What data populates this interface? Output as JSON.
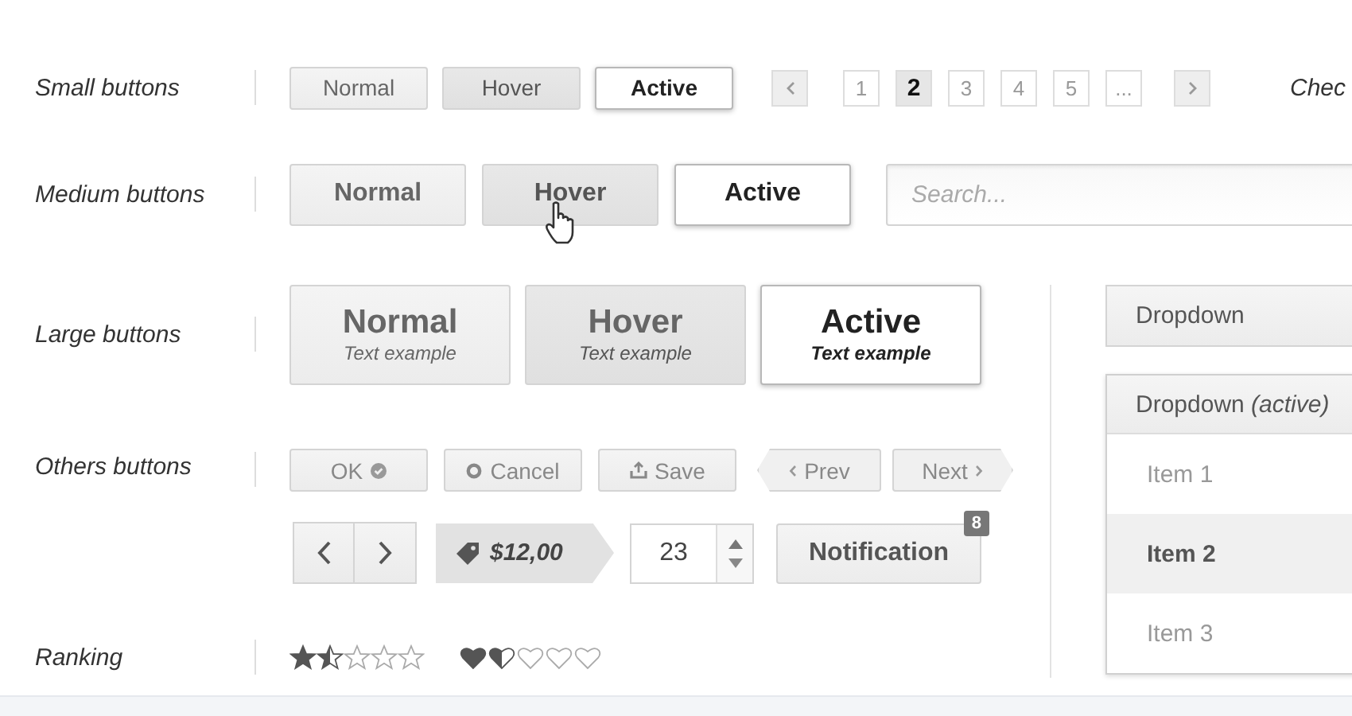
{
  "small_buttons": {
    "label": "Small buttons",
    "buttons": [
      {
        "label": "Normal",
        "kind": "normal"
      },
      {
        "label": "Hover",
        "kind": "hover"
      },
      {
        "label": "Active",
        "kind": "active"
      }
    ]
  },
  "pagination": {
    "pages": [
      {
        "label": "1",
        "selected": false
      },
      {
        "label": "2",
        "selected": true
      },
      {
        "label": "3",
        "selected": false
      },
      {
        "label": "4",
        "selected": false
      },
      {
        "label": "5",
        "selected": false
      },
      {
        "label": "...",
        "selected": false
      }
    ]
  },
  "checkbox_section_label": "Chec",
  "medium_buttons": {
    "label": "Medium buttons",
    "buttons": [
      {
        "label": "Normal",
        "kind": "normal",
        "pointer": false
      },
      {
        "label": "Hover",
        "kind": "hover",
        "pointer": true
      },
      {
        "label": "Active",
        "kind": "active",
        "pointer": false
      }
    ]
  },
  "search": {
    "placeholder": "Search..."
  },
  "large_buttons": {
    "label": "Large buttons",
    "buttons": [
      {
        "label": "Normal",
        "subtitle": "Text example",
        "kind": "normal"
      },
      {
        "label": "Hover",
        "subtitle": "Text example",
        "kind": "hover"
      },
      {
        "label": "Active",
        "subtitle": "Text example",
        "kind": "active"
      }
    ]
  },
  "others": {
    "label": "Others buttons",
    "ok": "OK",
    "cancel": "Cancel",
    "save": "Save",
    "prev": "Prev",
    "next": "Next",
    "price": "$12,00",
    "spinner_value": "23",
    "notification": "Notification",
    "badge": "8"
  },
  "ranking": {
    "label": "Ranking",
    "star_rating": {
      "stars": 1.5
    },
    "heart_rating": {
      "stars": 1.5
    }
  },
  "dropdown": {
    "label": "Dropdown"
  },
  "dropdown_active": {
    "label": "Dropdown *(active)*",
    "items": [
      {
        "label": "Item 1",
        "selected": false
      },
      {
        "label": "Item 2",
        "selected": true
      },
      {
        "label": "Item 3",
        "selected": false
      }
    ]
  }
}
